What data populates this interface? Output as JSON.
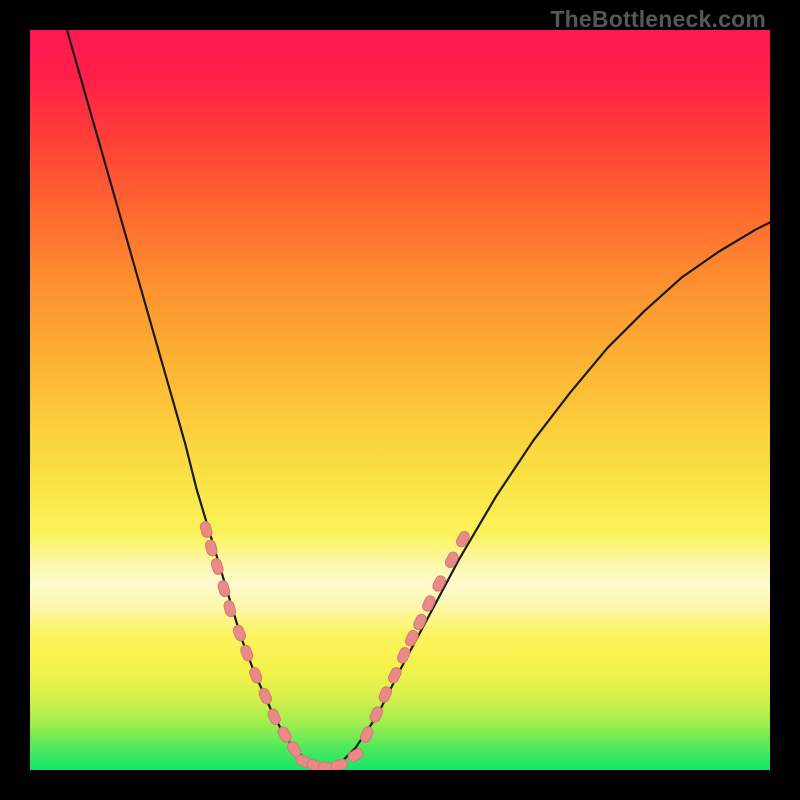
{
  "branding": {
    "text": "TheBottleneck.com"
  },
  "colors": {
    "curve_stroke": "#1a1a1a",
    "marker_fill": "#e98a86",
    "marker_stroke": "#d77772"
  },
  "chart_data": {
    "type": "line",
    "title": "",
    "xlabel": "",
    "ylabel": "",
    "xlim": [
      0,
      1
    ],
    "ylim": [
      0,
      1
    ],
    "annotations": [
      "TheBottleneck.com"
    ],
    "series": [
      {
        "name": "bottleneck-curve",
        "x": [
          0.05,
          0.07,
          0.09,
          0.11,
          0.13,
          0.15,
          0.17,
          0.19,
          0.21,
          0.225,
          0.24,
          0.255,
          0.27,
          0.285,
          0.3,
          0.315,
          0.33,
          0.345,
          0.36,
          0.38,
          0.4,
          0.42,
          0.44,
          0.47,
          0.5,
          0.54,
          0.58,
          0.63,
          0.68,
          0.73,
          0.78,
          0.83,
          0.88,
          0.93,
          0.98,
          1.0
        ],
        "y": [
          1.0,
          0.93,
          0.86,
          0.79,
          0.72,
          0.65,
          0.58,
          0.51,
          0.44,
          0.38,
          0.33,
          0.28,
          0.23,
          0.18,
          0.14,
          0.105,
          0.072,
          0.045,
          0.025,
          0.01,
          0.003,
          0.01,
          0.03,
          0.075,
          0.135,
          0.21,
          0.285,
          0.37,
          0.445,
          0.51,
          0.57,
          0.62,
          0.665,
          0.7,
          0.73,
          0.74
        ]
      },
      {
        "name": "marker-cluster-left",
        "type": "scatter",
        "x": [
          0.238,
          0.245,
          0.253,
          0.262,
          0.27,
          0.283,
          0.293,
          0.305,
          0.318,
          0.33,
          0.344,
          0.357
        ],
        "y": [
          0.325,
          0.3,
          0.275,
          0.245,
          0.218,
          0.185,
          0.158,
          0.128,
          0.1,
          0.072,
          0.048,
          0.028
        ]
      },
      {
        "name": "marker-cluster-bottom",
        "type": "scatter",
        "x": [
          0.37,
          0.385,
          0.4,
          0.418,
          0.44
        ],
        "y": [
          0.012,
          0.006,
          0.003,
          0.007,
          0.02
        ]
      },
      {
        "name": "marker-cluster-right",
        "type": "scatter",
        "x": [
          0.455,
          0.468,
          0.48,
          0.493,
          0.505,
          0.516,
          0.527,
          0.539,
          0.553,
          0.57,
          0.585
        ],
        "y": [
          0.048,
          0.075,
          0.102,
          0.128,
          0.155,
          0.178,
          0.2,
          0.225,
          0.252,
          0.284,
          0.312
        ]
      }
    ]
  }
}
